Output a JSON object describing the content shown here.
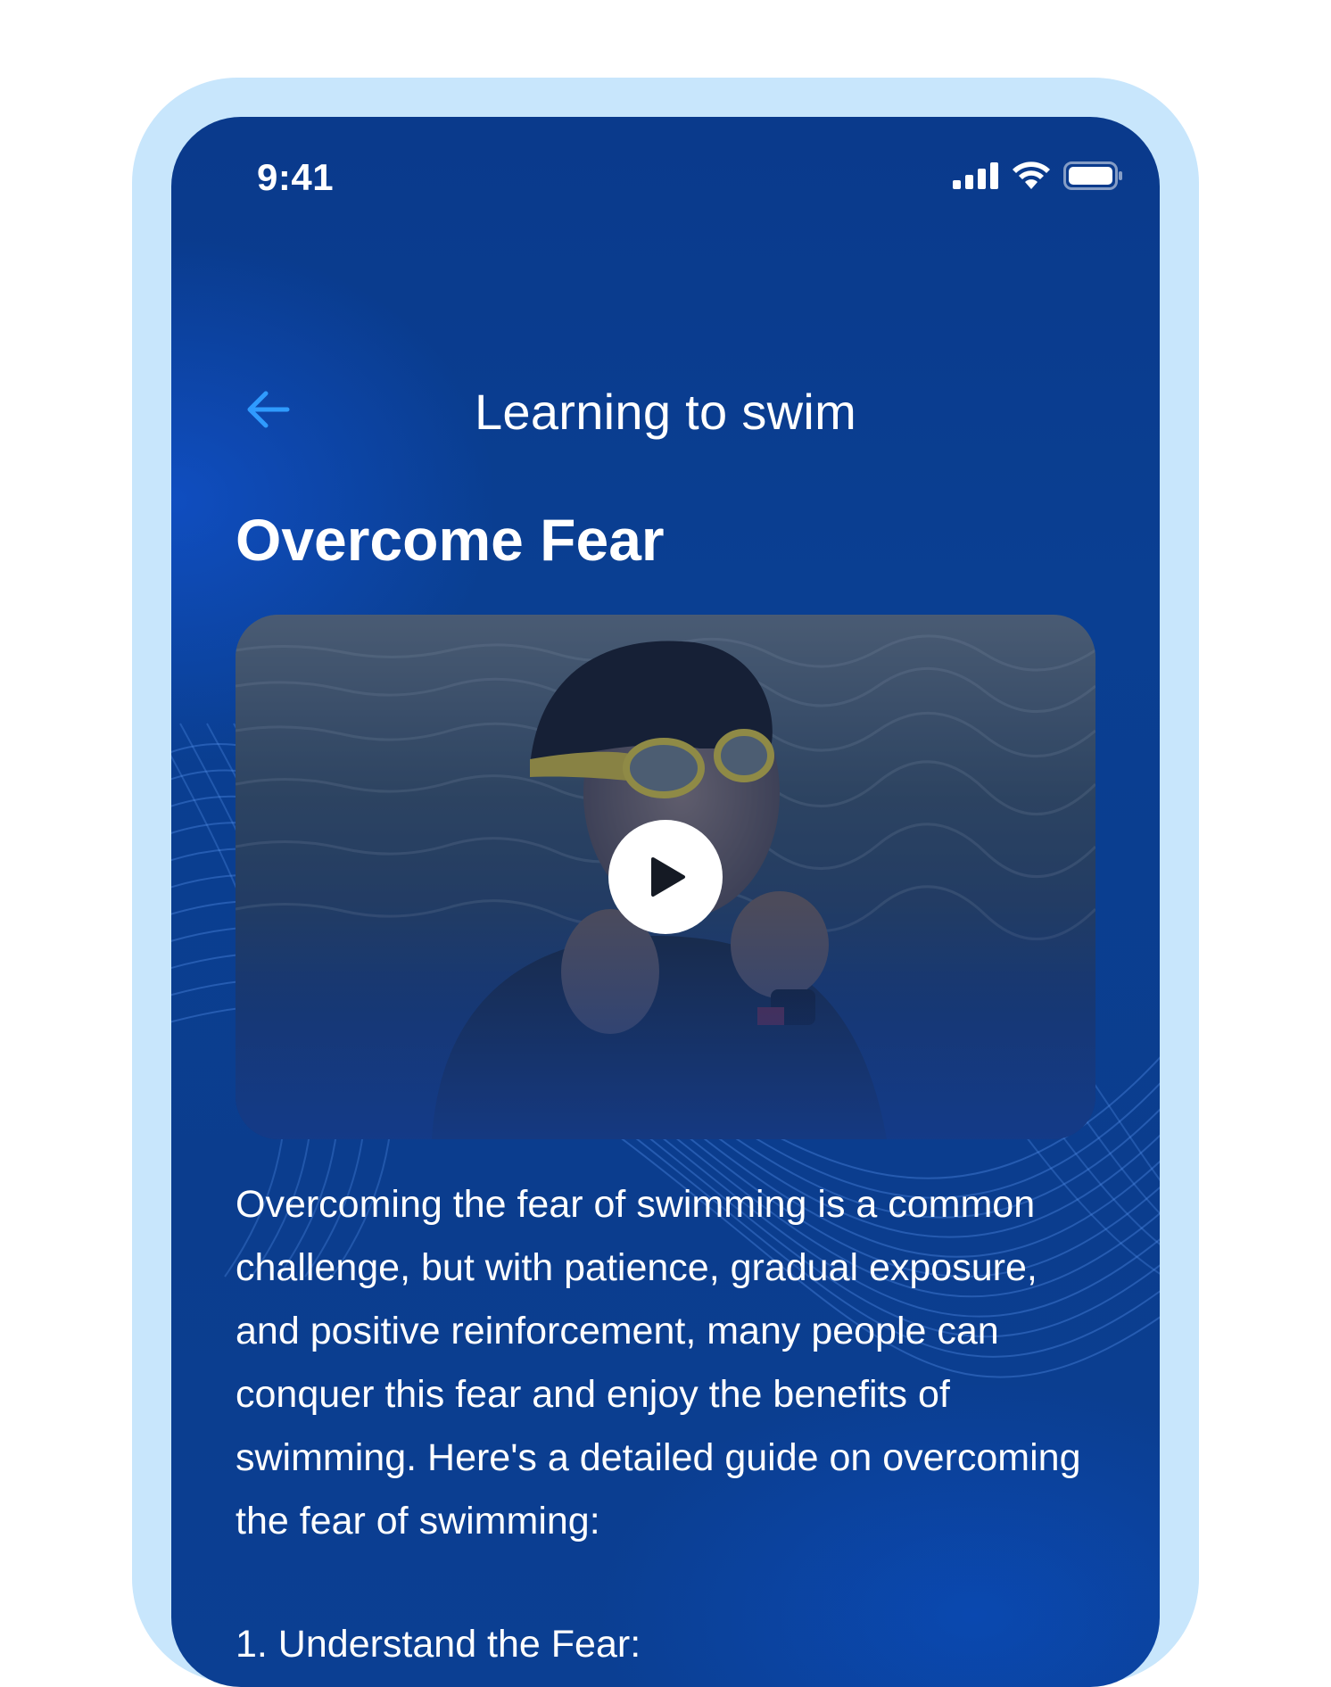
{
  "status_bar": {
    "time": "9:41"
  },
  "header": {
    "title": "Learning to swim",
    "back_icon": "arrow-left-icon"
  },
  "lesson": {
    "title": "Overcome Fear",
    "video": {
      "play_icon": "play-icon"
    },
    "body": "Overcoming the fear of swimming is a common challenge, but with patience, gradual exposure, and positive reinforcement, many people can conquer this fear and enjoy the benefits of swimming. Here's a detailed guide on overcoming the fear of swimming:",
    "section_heading": "1. Understand the Fear:"
  },
  "colors": {
    "frame": "#c8e6fc",
    "screen_background": "#0b3d8e",
    "accent": "#2f9bff",
    "text": "#ffffff"
  }
}
